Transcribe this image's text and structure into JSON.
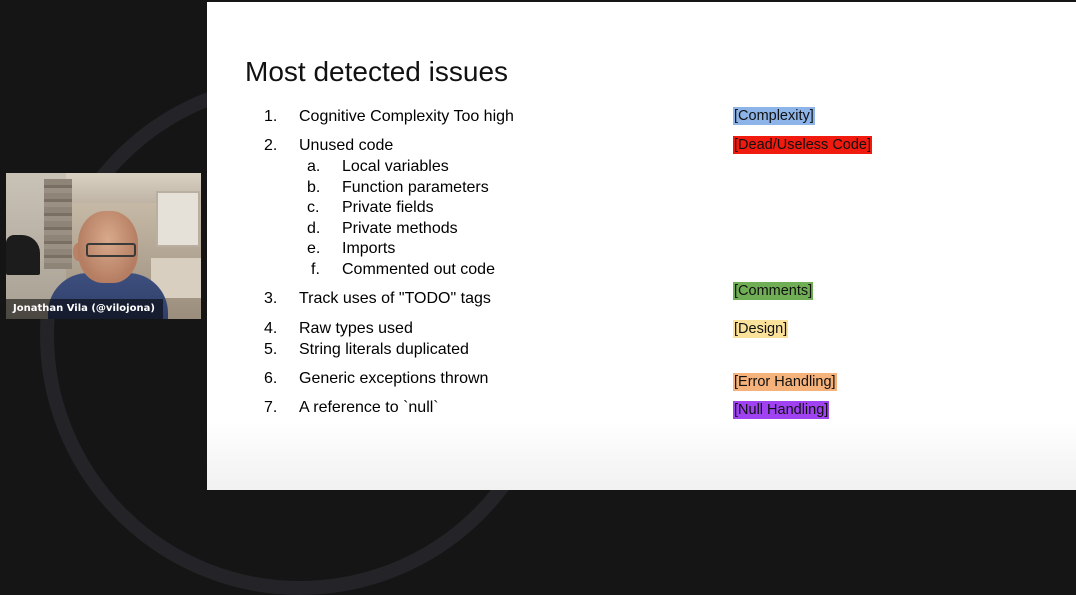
{
  "participant": {
    "name": "Jonathan Vila (@vilojona)"
  },
  "slide": {
    "title": "Most detected issues",
    "items": [
      {
        "num": "1.",
        "text": "Cognitive Complexity Too high"
      },
      {
        "num": "2.",
        "text": "Unused code"
      },
      {
        "num": "3.",
        "text": "Track uses of \"TODO\" tags"
      },
      {
        "num": "4.",
        "text": "Raw types used"
      },
      {
        "num": "5.",
        "text": "String literals duplicated"
      },
      {
        "num": "6.",
        "text": "Generic exceptions thrown"
      },
      {
        "num": "7.",
        "text": "A reference to `null`"
      }
    ],
    "subitems": [
      {
        "num": "a.",
        "text": "Local variables"
      },
      {
        "num": "b.",
        "text": "Function parameters"
      },
      {
        "num": "c.",
        "text": "Private fields"
      },
      {
        "num": "d.",
        "text": "Private methods"
      },
      {
        "num": "e.",
        "text": "Imports"
      },
      {
        "num": "f.",
        "text": "Commented out code"
      }
    ],
    "tags": [
      {
        "text": "[Complexity]",
        "color": "#8db4e8"
      },
      {
        "text": "[Dead/Useless Code]",
        "color": "#f11a0f"
      },
      {
        "text": "[Comments]",
        "color": "#6fae55"
      },
      {
        "text": "[Design]",
        "color": "#fbe29b"
      },
      {
        "text": "[Error Handling]",
        "color": "#f5b27a"
      },
      {
        "text": "[Null Handling]",
        "color": "#a042f2"
      }
    ]
  }
}
